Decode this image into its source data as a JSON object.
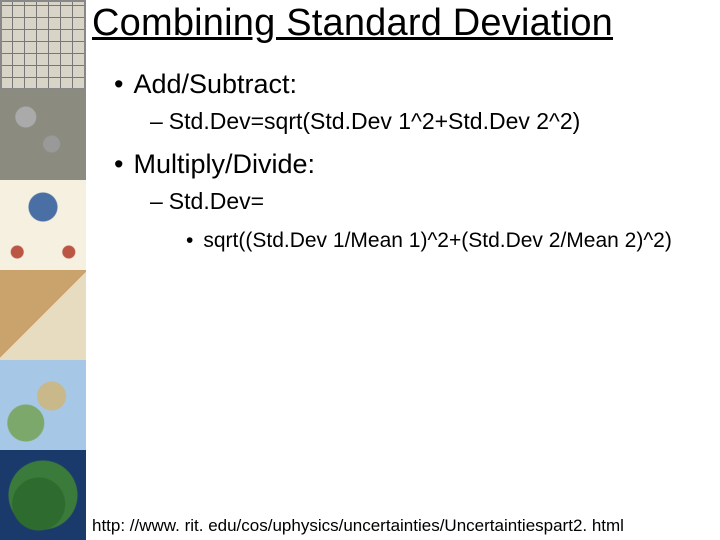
{
  "title": "Combining Standard Deviation",
  "bullets": {
    "b1": "Add/Subtract:",
    "b1s1": "Std.Dev=sqrt(Std.Dev 1^2+Std.Dev 2^2)",
    "b2": "Multiply/Divide:",
    "b2s1": "Std.Dev=",
    "b2s1a": "sqrt((Std.Dev 1/Mean 1)^2+(Std.Dev 2/Mean 2)^2)"
  },
  "footer": "http: //www. rit. edu/cos/uphysics/uncertainties/Uncertaintiespart2. html",
  "sidebar_thumbs": [
    "grid-map",
    "clay-tablet",
    "medieval-map",
    "parchment-map",
    "greece-map",
    "globe"
  ]
}
